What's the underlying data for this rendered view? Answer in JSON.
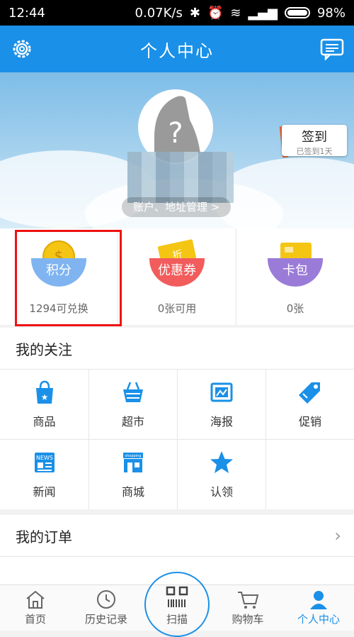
{
  "status_bar": {
    "time": "12:44",
    "network_speed": "0.07K/s",
    "battery": "98%"
  },
  "header": {
    "title": "个人中心",
    "settings_icon": "gear-icon",
    "message_icon": "message-icon"
  },
  "profile": {
    "avatar_placeholder": "?",
    "account_link": "账户、地址管理 >",
    "checkin_label": "签到",
    "checkin_sub": "已签到1天"
  },
  "stats": [
    {
      "badge": "积分",
      "sub": "1294可兑换",
      "color": "#7fb4f0",
      "icon": "coin-icon"
    },
    {
      "badge": "优惠券",
      "sub": "0张可用",
      "color": "#f25c5c",
      "icon": "coupon-icon"
    },
    {
      "badge": "卡包",
      "sub": "0张",
      "color": "#9b7bd8",
      "icon": "card-icon"
    }
  ],
  "follow": {
    "title": "我的关注",
    "items": [
      {
        "label": "商品",
        "icon": "shopping-bag-icon"
      },
      {
        "label": "超市",
        "icon": "basket-icon"
      },
      {
        "label": "海报",
        "icon": "poster-icon"
      },
      {
        "label": "促销",
        "icon": "tag-icon"
      },
      {
        "label": "新闻",
        "icon": "news-icon"
      },
      {
        "label": "商城",
        "icon": "shop-icon"
      },
      {
        "label": "认领",
        "icon": "star-icon"
      }
    ]
  },
  "orders": {
    "title": "我的订单"
  },
  "tabbar": [
    {
      "label": "首页",
      "icon": "home-icon"
    },
    {
      "label": "历史记录",
      "icon": "clock-icon"
    },
    {
      "label": "扫描",
      "icon": "scan-icon"
    },
    {
      "label": "购物车",
      "icon": "cart-icon"
    },
    {
      "label": "个人中心",
      "icon": "person-icon",
      "active": true
    }
  ],
  "colors": {
    "brand": "#1a90e8",
    "highlight": "#e11111"
  }
}
